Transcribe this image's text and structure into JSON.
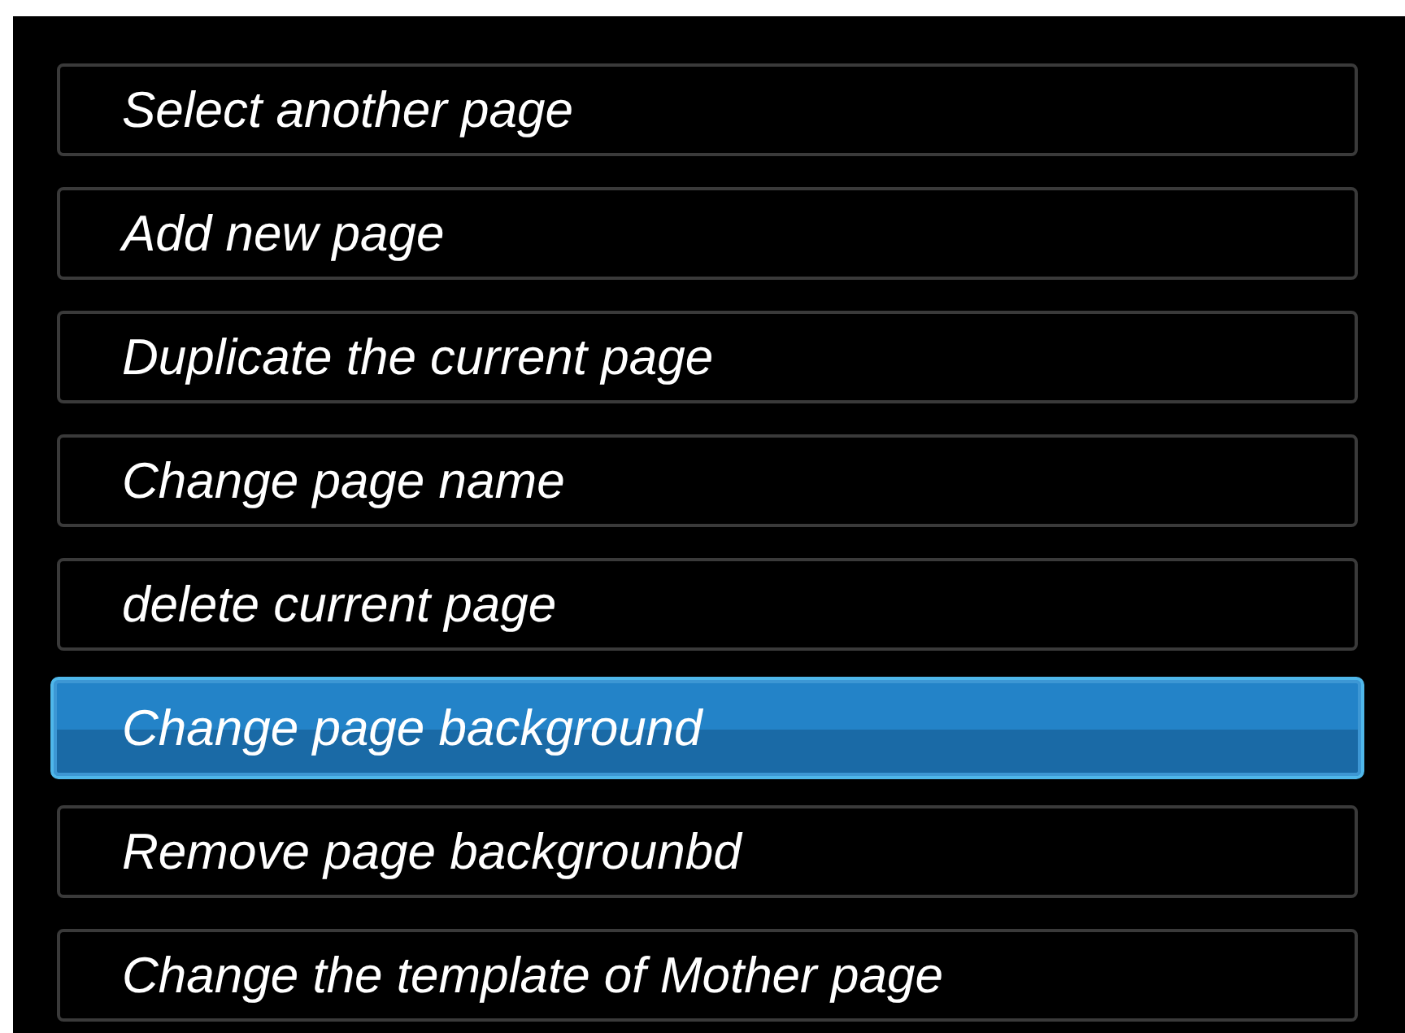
{
  "menu": {
    "items": [
      {
        "label": "Select another page",
        "selected": false
      },
      {
        "label": "Add new page",
        "selected": false
      },
      {
        "label": "Duplicate the current page",
        "selected": false
      },
      {
        "label": "Change page name",
        "selected": false
      },
      {
        "label": "delete current page",
        "selected": false
      },
      {
        "label": "Change page background",
        "selected": true
      },
      {
        "label": "Remove page backgrounbd",
        "selected": false
      },
      {
        "label": "Change the template of Mother page",
        "selected": false
      }
    ]
  }
}
